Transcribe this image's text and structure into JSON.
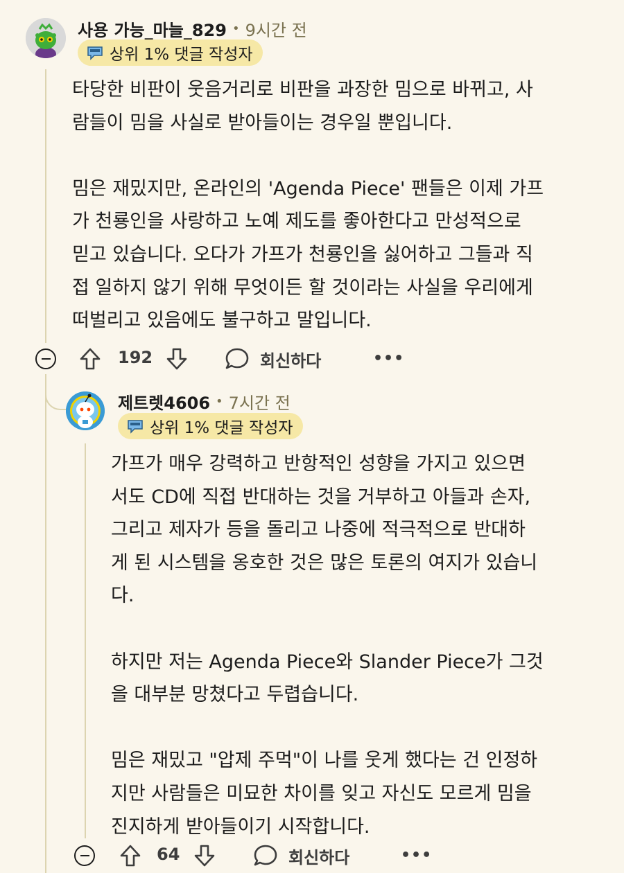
{
  "comments": [
    {
      "username": "사용 가능_마늘_829",
      "separator": "•",
      "time": "9시간 전",
      "flair": "상위 1% 댓글 작성자",
      "paragraphs": [
        [
          "타당한 비판이 웃음거리로 비판을 과장한 밈으로 바뀌고, 사",
          "람들이 밈을 사실로 받아들이는 경우일 뿐입니다."
        ],
        [
          "밈은 재밌지만, 온라인의 'Agenda Piece' 팬들은 이제 가프",
          "가 천룡인을 사랑하고 노예 제도를 좋아한다고 만성적으로",
          "믿고 있습니다. 오다가 가프가 천룡인을 싫어하고 그들과 직",
          "접 일하지 않기 위해 무엇이든 할 것이라는 사실을 우리에게",
          "떠벌리고 있음에도 불구하고 말입니다."
        ]
      ],
      "votes": "192",
      "reply_label": "회신하다",
      "more_label": "•••",
      "avatar": "snoo-green-avatar",
      "colors": {
        "avatar_bg": "#d9d9d9",
        "avatar_main": "#3fae3a"
      }
    },
    {
      "username": "제트렛4606",
      "separator": "•",
      "time": "7시간 전",
      "flair": "상위 1% 댓글 작성자",
      "paragraphs": [
        [
          "가프가 매우 강력하고 반항적인 성향을 가지고 있으면",
          "서도 CD에 직접 반대하는 것을 거부하고 아들과 손자,",
          "그리고 제자가 등을 돌리고 나중에 적극적으로 반대하",
          "게 된 시스템을 옹호한 것은 많은 토론의 여지가 있습니",
          "다."
        ],
        [
          "하지만 저는 Agenda Piece와 Slander Piece가 그것",
          "을 대부분 망쳤다고 두렵습니다."
        ],
        [
          "밈은 재밌고 \"압제 주먹\"이 나를 웃게 했다는 건 인정하",
          "지만 사람들은 미묘한 차이를 잊고 자신도 모르게 밈을",
          "진지하게 받아들이기 시작합니다."
        ]
      ],
      "votes": "64",
      "reply_label": "회신하다",
      "more_label": "•••",
      "avatar": "snoo-astronaut-avatar",
      "colors": {
        "avatar_bg": "#3a9bd5",
        "avatar_main": "#ffffff"
      }
    }
  ],
  "icons": {
    "flair_icon": "speech-bubble-badge-icon",
    "upvote": "arrow-up-icon",
    "downvote": "arrow-down-icon",
    "reply": "comment-bubble-icon",
    "collapse": "collapse-minus-icon"
  },
  "colors": {
    "background": "#faf6ec",
    "flair_bg": "#f6e8a6",
    "thread_line": "#dcd4b0",
    "meta_text": "#7a7250"
  }
}
